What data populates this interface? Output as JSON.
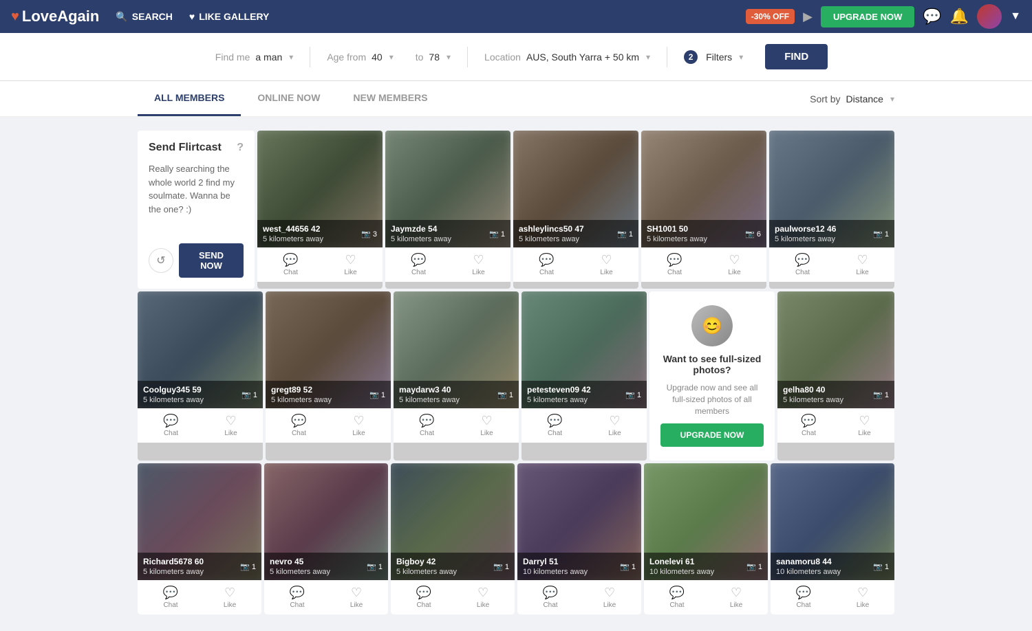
{
  "header": {
    "logo": "LoveAgain",
    "nav": [
      {
        "id": "search",
        "label": "SEARCH",
        "icon": "🔍"
      },
      {
        "id": "like-gallery",
        "label": "LIKE GALLERY",
        "icon": "♥"
      }
    ],
    "discount": "-30% OFF",
    "upgrade_label": "UPGRADE NOW",
    "arrow_icon": "▼"
  },
  "search_bar": {
    "find_me_label": "Find me",
    "find_me_value": "a man",
    "age_from_label": "Age from",
    "age_from_value": "40",
    "age_to_label": "to",
    "age_to_value": "78",
    "location_label": "Location",
    "location_value": "AUS, South Yarra + 50 km",
    "filters_count": "2",
    "filters_label": "Filters",
    "find_btn": "FIND"
  },
  "tabs": {
    "items": [
      {
        "id": "all-members",
        "label": "ALL MEMBERS",
        "active": true
      },
      {
        "id": "online-now",
        "label": "ONLINE NOW",
        "active": false
      },
      {
        "id": "new-members",
        "label": "NEW MEMBERS",
        "active": false
      }
    ],
    "sort_label": "Sort by",
    "sort_value": "Distance"
  },
  "flirtcast": {
    "title": "Send Flirtcast",
    "text": "Really searching the whole world 2 find my soulmate. Wanna be the one? :)",
    "send_btn": "SEND NOW",
    "refresh_icon": "↺",
    "info_icon": "?"
  },
  "members_row1": [
    {
      "name": "west_44656",
      "age": "42",
      "distance": "5 kilometers away",
      "photos": "3",
      "photo_class": "photo-1"
    },
    {
      "name": "Jaymzde",
      "age": "54",
      "distance": "5 kilometers away",
      "photos": "1",
      "photo_class": "photo-2"
    },
    {
      "name": "ashleylincs50",
      "age": "47",
      "distance": "5 kilometers away",
      "photos": "1",
      "photo_class": "photo-3"
    },
    {
      "name": "SH1001",
      "age": "50",
      "distance": "5 kilometers away",
      "photos": "6",
      "photo_class": "photo-4"
    },
    {
      "name": "paulworse12",
      "age": "46",
      "distance": "5 kilometers away",
      "photos": "1",
      "photo_class": "photo-5"
    }
  ],
  "members_row2": [
    {
      "name": "Coolguy345",
      "age": "59",
      "distance": "5 kilometers away",
      "photos": "1",
      "photo_class": "photo-6"
    },
    {
      "name": "gregt89",
      "age": "52",
      "distance": "5 kilometers away",
      "photos": "1",
      "photo_class": "photo-7"
    },
    {
      "name": "maydarw3",
      "age": "40",
      "distance": "5 kilometers away",
      "photos": "1",
      "photo_class": "photo-8"
    },
    {
      "name": "petesteven09",
      "age": "42",
      "distance": "5 kilometers away",
      "photos": "1",
      "photo_class": "photo-9"
    },
    {
      "name": "gelha80",
      "age": "40",
      "distance": "5 kilometers away",
      "photos": "1",
      "photo_class": "photo-10"
    }
  ],
  "upgrade_widget": {
    "title": "Want to see full-sized photos?",
    "text": "Upgrade now and see all full-sized photos of all members",
    "btn_label": "UPGRADE NOW"
  },
  "members_row3": [
    {
      "name": "Richard5678",
      "age": "60",
      "distance": "5 kilometers away",
      "photos": "1",
      "photo_class": "photo-r1"
    },
    {
      "name": "nevro",
      "age": "45",
      "distance": "5 kilometers away",
      "photos": "1",
      "photo_class": "photo-r2"
    },
    {
      "name": "Bigboy",
      "age": "42",
      "distance": "5 kilometers away",
      "photos": "1",
      "photo_class": "photo-r3"
    },
    {
      "name": "Darryl",
      "age": "51",
      "distance": "10 kilometers away",
      "photos": "1",
      "photo_class": "photo-r4"
    },
    {
      "name": "Lonelevi",
      "age": "61",
      "distance": "10 kilometers away",
      "photos": "1",
      "photo_class": "photo-r5"
    },
    {
      "name": "sanamoru8",
      "age": "44",
      "distance": "10 kilometers away",
      "photos": "1",
      "photo_class": "photo-r6"
    }
  ],
  "actions": {
    "chat": "Chat",
    "like": "Like",
    "chat_icon": "💬",
    "like_icon": "♡"
  }
}
